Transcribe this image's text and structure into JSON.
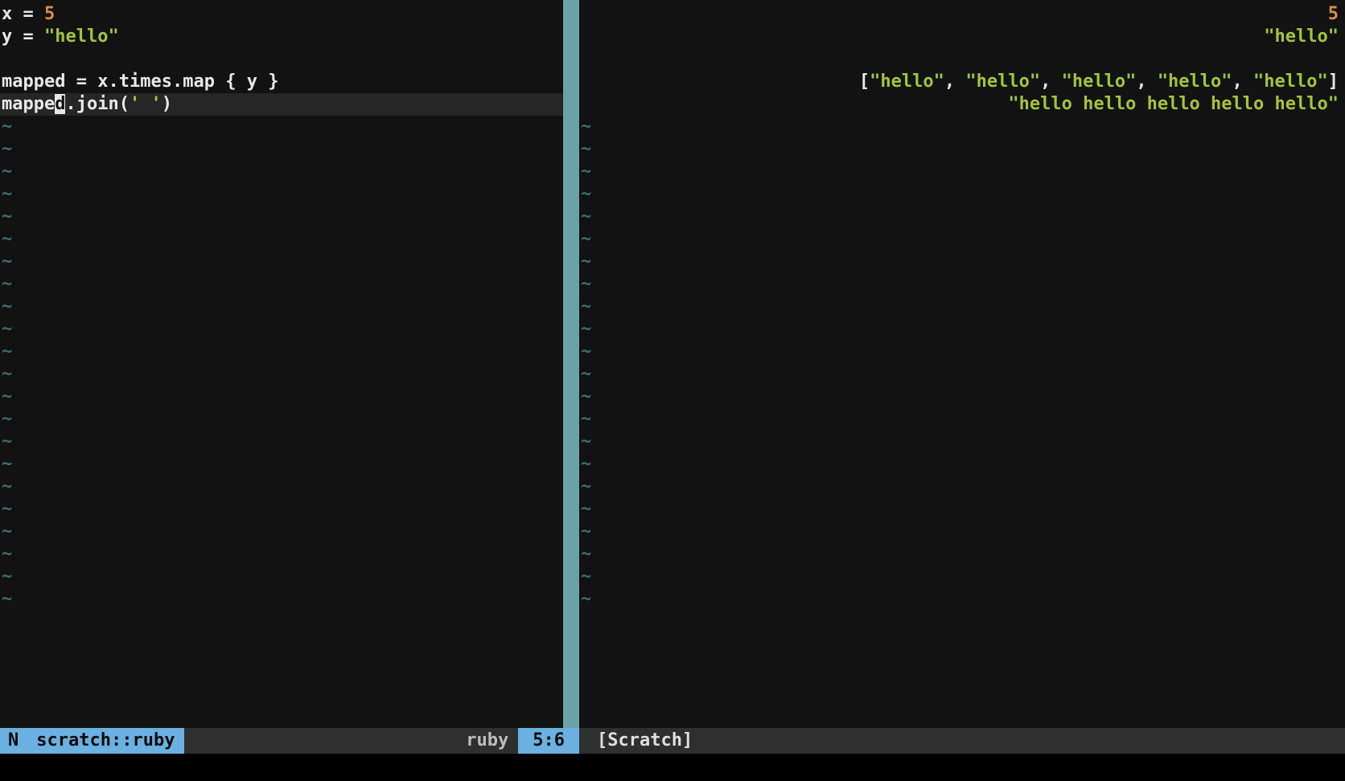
{
  "left_pane": {
    "lines": [
      {
        "tokens": [
          {
            "t": "x",
            "c": "tok-id"
          },
          {
            "t": " = ",
            "c": "tok-op"
          },
          {
            "t": "5",
            "c": "tok-num"
          }
        ]
      },
      {
        "tokens": [
          {
            "t": "y",
            "c": "tok-id"
          },
          {
            "t": " = ",
            "c": "tok-op"
          },
          {
            "t": "\"hello\"",
            "c": "tok-str"
          }
        ]
      },
      {
        "tokens": []
      },
      {
        "tokens": [
          {
            "t": "mapped",
            "c": "tok-id"
          },
          {
            "t": " = ",
            "c": "tok-op"
          },
          {
            "t": "x",
            "c": "tok-id"
          },
          {
            "t": ".",
            "c": "tok-punct"
          },
          {
            "t": "times",
            "c": "tok-id"
          },
          {
            "t": ".",
            "c": "tok-punct"
          },
          {
            "t": "map",
            "c": "tok-id"
          },
          {
            "t": " { ",
            "c": "tok-punct"
          },
          {
            "t": "y",
            "c": "tok-id"
          },
          {
            "t": " }",
            "c": "tok-punct"
          }
        ]
      },
      {
        "current": true,
        "tokens": [
          {
            "t": "mappe",
            "c": "tok-id"
          },
          {
            "t": "d",
            "c": "cursor-block"
          },
          {
            "t": ".",
            "c": "tok-punct"
          },
          {
            "t": "join",
            "c": "tok-id"
          },
          {
            "t": "(",
            "c": "tok-punct"
          },
          {
            "t": "' '",
            "c": "tok-str"
          },
          {
            "t": ")",
            "c": "tok-punct"
          }
        ]
      }
    ],
    "tilde_count": 22
  },
  "right_pane": {
    "lines": [
      {
        "tokens": [
          {
            "t": "5",
            "c": "tok-num"
          }
        ]
      },
      {
        "tokens": [
          {
            "t": "\"hello\"",
            "c": "tok-str"
          }
        ]
      },
      {
        "tokens": []
      },
      {
        "tokens": [
          {
            "t": "[",
            "c": "tok-punct"
          },
          {
            "t": "\"hello\"",
            "c": "tok-str"
          },
          {
            "t": ", ",
            "c": "tok-punct"
          },
          {
            "t": "\"hello\"",
            "c": "tok-str"
          },
          {
            "t": ", ",
            "c": "tok-punct"
          },
          {
            "t": "\"hello\"",
            "c": "tok-str"
          },
          {
            "t": ", ",
            "c": "tok-punct"
          },
          {
            "t": "\"hello\"",
            "c": "tok-str"
          },
          {
            "t": ", ",
            "c": "tok-punct"
          },
          {
            "t": "\"hello\"",
            "c": "tok-str"
          },
          {
            "t": "]",
            "c": "tok-punct"
          }
        ]
      },
      {
        "tokens": [
          {
            "t": "\"hello hello hello hello hello\"",
            "c": "tok-str"
          }
        ]
      }
    ],
    "tilde_count": 22
  },
  "status": {
    "mode": "N",
    "file": "scratch::ruby",
    "filetype": "ruby",
    "position": "5:6",
    "scratch_label": "[Scratch]"
  },
  "colors": {
    "bg": "#121212",
    "vsplit": "#6aa3a6",
    "status_active_bg": "#6ab1e1",
    "status_inactive_bg": "#2f2f2f",
    "number": "#d98e48",
    "string": "#a7c23c",
    "tilde": "#3c6e71"
  }
}
